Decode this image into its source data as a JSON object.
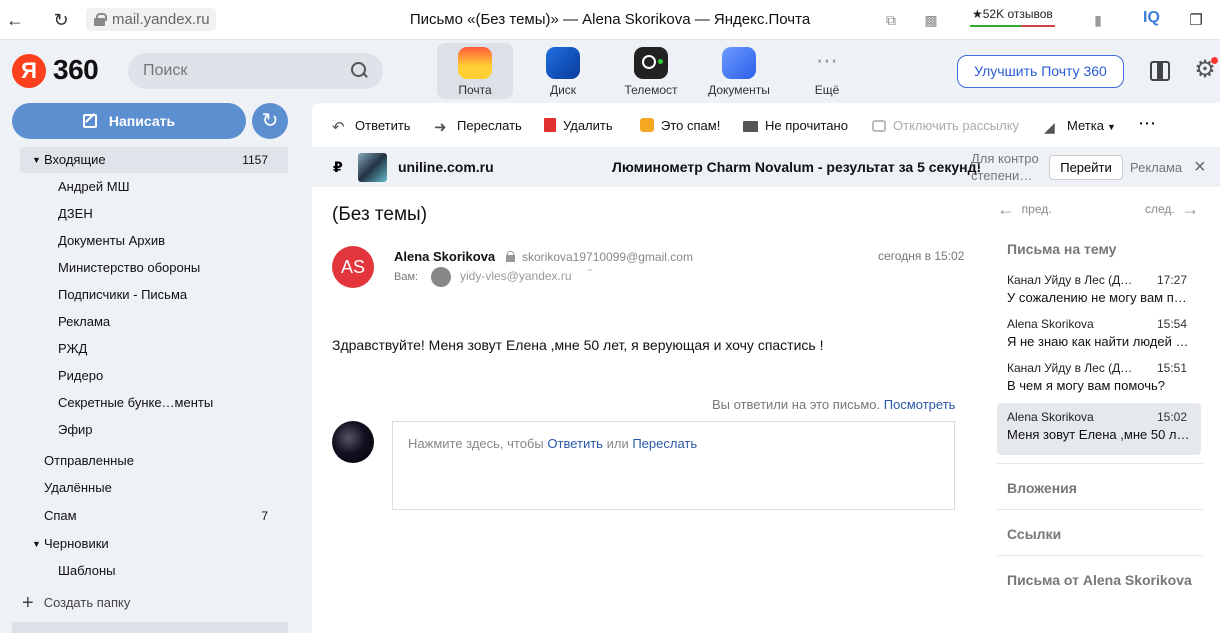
{
  "browser": {
    "url": "mail.yandex.ru",
    "page_title": "Письмо «(Без темы)» — Alena Skorikova — Яндекс.Почта",
    "reviews": "★52K отзывов",
    "iq_label": "IQ"
  },
  "header": {
    "logo_letter": "Я",
    "logo_360": "360",
    "search_placeholder": "Поиск",
    "services": [
      {
        "label": "Почта",
        "color": "#ffcf33"
      },
      {
        "label": "Диск",
        "color": "#1e6fe0"
      },
      {
        "label": "Телемост",
        "color": "#222222"
      },
      {
        "label": "Документы",
        "color": "#4c7cf0"
      },
      {
        "label": "Ещё",
        "color": "#9aa0a6"
      }
    ],
    "upgrade_label": "Улучшить Почту 360",
    "accent_color": "#fc3f1d"
  },
  "sidebar": {
    "compose_label": "Написать",
    "folders": [
      {
        "name": "Входящие",
        "count": "1157"
      },
      {
        "name": "Андрей МШ"
      },
      {
        "name": "ДЗЕН"
      },
      {
        "name": "Документы Архив"
      },
      {
        "name": "Министерство обороны"
      },
      {
        "name": "Подписчики - Письма"
      },
      {
        "name": "Реклама"
      },
      {
        "name": "РЖД"
      },
      {
        "name": "Ридеро"
      },
      {
        "name": "Секретные бунке…менты"
      },
      {
        "name": "Эфир"
      },
      {
        "name": "Отправленные"
      },
      {
        "name": "Удалённые"
      },
      {
        "name": "Спам",
        "count": "7"
      },
      {
        "name": "Черновики"
      },
      {
        "name": "Шаблоны"
      }
    ],
    "create_folder": "Создать папку"
  },
  "toolbar": {
    "reply": "Ответить",
    "forward": "Переслать",
    "delete": "Удалить",
    "spam": "Это спам!",
    "unread": "Не прочитано",
    "unsubscribe": "Отключить рассылку",
    "label": "Метка",
    "more": "⋯"
  },
  "ad": {
    "currency": "₽",
    "domain": "uniline.com.ru",
    "text": "Люминометр Charm Novalum - результат за 5 секунд!",
    "note": "Для контро степени…",
    "go": "Перейти",
    "label": "Реклама"
  },
  "message": {
    "subject": "(Без темы)",
    "avatar_initials": "AS",
    "sender_name": "Alena Skorikova",
    "sender_email": "skorikova19710099@gmail.com",
    "date": "сегодня в 15:02",
    "to_label": "Вам:",
    "to_email": "yidy-vles@yandex.ru",
    "body": "Здравствуйте! Меня зовут Елена ,мне 50 лет, я верующая и хочу спастись !",
    "replied_text": "Вы ответили на это письмо.",
    "replied_link": "Посмотреть",
    "reply_prompt_a": "Нажмите здесь, чтобы",
    "reply_prompt_reply": "Ответить",
    "reply_prompt_or": "или",
    "reply_prompt_forward": "Переслать"
  },
  "right": {
    "prev": "пред.",
    "next": "след.",
    "thread_title": "Письма на тему",
    "threads": [
      {
        "from": "Канал Уйду в Лес (Д…",
        "time": "17:27",
        "preview": "У сожалению не могу вам п…"
      },
      {
        "from": "Alena Skorikova",
        "time": "15:54",
        "preview": "Я не знаю как найти людей …"
      },
      {
        "from": "Канал Уйду в Лес (Д…",
        "time": "15:51",
        "preview": "В чем я могу вам помочь?"
      },
      {
        "from": "Alena Skorikova",
        "time": "15:02",
        "preview": "Меня зовут Елена ,мне 50 л…"
      }
    ],
    "attachments": "Вложения",
    "links": "Ссылки",
    "from_sender": "Письма от Alena Skorikova"
  }
}
